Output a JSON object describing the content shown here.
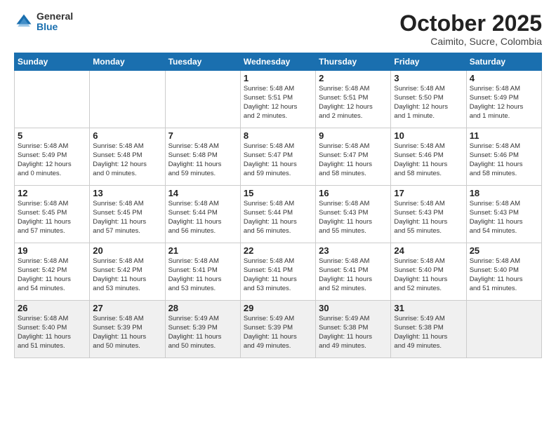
{
  "logo": {
    "general": "General",
    "blue": "Blue"
  },
  "title": "October 2025",
  "location": "Caimito, Sucre, Colombia",
  "days_of_week": [
    "Sunday",
    "Monday",
    "Tuesday",
    "Wednesday",
    "Thursday",
    "Friday",
    "Saturday"
  ],
  "weeks": [
    [
      {
        "day": "",
        "info": ""
      },
      {
        "day": "",
        "info": ""
      },
      {
        "day": "",
        "info": ""
      },
      {
        "day": "1",
        "info": "Sunrise: 5:48 AM\nSunset: 5:51 PM\nDaylight: 12 hours\nand 2 minutes."
      },
      {
        "day": "2",
        "info": "Sunrise: 5:48 AM\nSunset: 5:51 PM\nDaylight: 12 hours\nand 2 minutes."
      },
      {
        "day": "3",
        "info": "Sunrise: 5:48 AM\nSunset: 5:50 PM\nDaylight: 12 hours\nand 1 minute."
      },
      {
        "day": "4",
        "info": "Sunrise: 5:48 AM\nSunset: 5:49 PM\nDaylight: 12 hours\nand 1 minute."
      }
    ],
    [
      {
        "day": "5",
        "info": "Sunrise: 5:48 AM\nSunset: 5:49 PM\nDaylight: 12 hours\nand 0 minutes."
      },
      {
        "day": "6",
        "info": "Sunrise: 5:48 AM\nSunset: 5:48 PM\nDaylight: 12 hours\nand 0 minutes."
      },
      {
        "day": "7",
        "info": "Sunrise: 5:48 AM\nSunset: 5:48 PM\nDaylight: 11 hours\nand 59 minutes."
      },
      {
        "day": "8",
        "info": "Sunrise: 5:48 AM\nSunset: 5:47 PM\nDaylight: 11 hours\nand 59 minutes."
      },
      {
        "day": "9",
        "info": "Sunrise: 5:48 AM\nSunset: 5:47 PM\nDaylight: 11 hours\nand 58 minutes."
      },
      {
        "day": "10",
        "info": "Sunrise: 5:48 AM\nSunset: 5:46 PM\nDaylight: 11 hours\nand 58 minutes."
      },
      {
        "day": "11",
        "info": "Sunrise: 5:48 AM\nSunset: 5:46 PM\nDaylight: 11 hours\nand 58 minutes."
      }
    ],
    [
      {
        "day": "12",
        "info": "Sunrise: 5:48 AM\nSunset: 5:45 PM\nDaylight: 11 hours\nand 57 minutes."
      },
      {
        "day": "13",
        "info": "Sunrise: 5:48 AM\nSunset: 5:45 PM\nDaylight: 11 hours\nand 57 minutes."
      },
      {
        "day": "14",
        "info": "Sunrise: 5:48 AM\nSunset: 5:44 PM\nDaylight: 11 hours\nand 56 minutes."
      },
      {
        "day": "15",
        "info": "Sunrise: 5:48 AM\nSunset: 5:44 PM\nDaylight: 11 hours\nand 56 minutes."
      },
      {
        "day": "16",
        "info": "Sunrise: 5:48 AM\nSunset: 5:43 PM\nDaylight: 11 hours\nand 55 minutes."
      },
      {
        "day": "17",
        "info": "Sunrise: 5:48 AM\nSunset: 5:43 PM\nDaylight: 11 hours\nand 55 minutes."
      },
      {
        "day": "18",
        "info": "Sunrise: 5:48 AM\nSunset: 5:43 PM\nDaylight: 11 hours\nand 54 minutes."
      }
    ],
    [
      {
        "day": "19",
        "info": "Sunrise: 5:48 AM\nSunset: 5:42 PM\nDaylight: 11 hours\nand 54 minutes."
      },
      {
        "day": "20",
        "info": "Sunrise: 5:48 AM\nSunset: 5:42 PM\nDaylight: 11 hours\nand 53 minutes."
      },
      {
        "day": "21",
        "info": "Sunrise: 5:48 AM\nSunset: 5:41 PM\nDaylight: 11 hours\nand 53 minutes."
      },
      {
        "day": "22",
        "info": "Sunrise: 5:48 AM\nSunset: 5:41 PM\nDaylight: 11 hours\nand 53 minutes."
      },
      {
        "day": "23",
        "info": "Sunrise: 5:48 AM\nSunset: 5:41 PM\nDaylight: 11 hours\nand 52 minutes."
      },
      {
        "day": "24",
        "info": "Sunrise: 5:48 AM\nSunset: 5:40 PM\nDaylight: 11 hours\nand 52 minutes."
      },
      {
        "day": "25",
        "info": "Sunrise: 5:48 AM\nSunset: 5:40 PM\nDaylight: 11 hours\nand 51 minutes."
      }
    ],
    [
      {
        "day": "26",
        "info": "Sunrise: 5:48 AM\nSunset: 5:40 PM\nDaylight: 11 hours\nand 51 minutes."
      },
      {
        "day": "27",
        "info": "Sunrise: 5:48 AM\nSunset: 5:39 PM\nDaylight: 11 hours\nand 50 minutes."
      },
      {
        "day": "28",
        "info": "Sunrise: 5:49 AM\nSunset: 5:39 PM\nDaylight: 11 hours\nand 50 minutes."
      },
      {
        "day": "29",
        "info": "Sunrise: 5:49 AM\nSunset: 5:39 PM\nDaylight: 11 hours\nand 49 minutes."
      },
      {
        "day": "30",
        "info": "Sunrise: 5:49 AM\nSunset: 5:38 PM\nDaylight: 11 hours\nand 49 minutes."
      },
      {
        "day": "31",
        "info": "Sunrise: 5:49 AM\nSunset: 5:38 PM\nDaylight: 11 hours\nand 49 minutes."
      },
      {
        "day": "",
        "info": ""
      }
    ]
  ]
}
